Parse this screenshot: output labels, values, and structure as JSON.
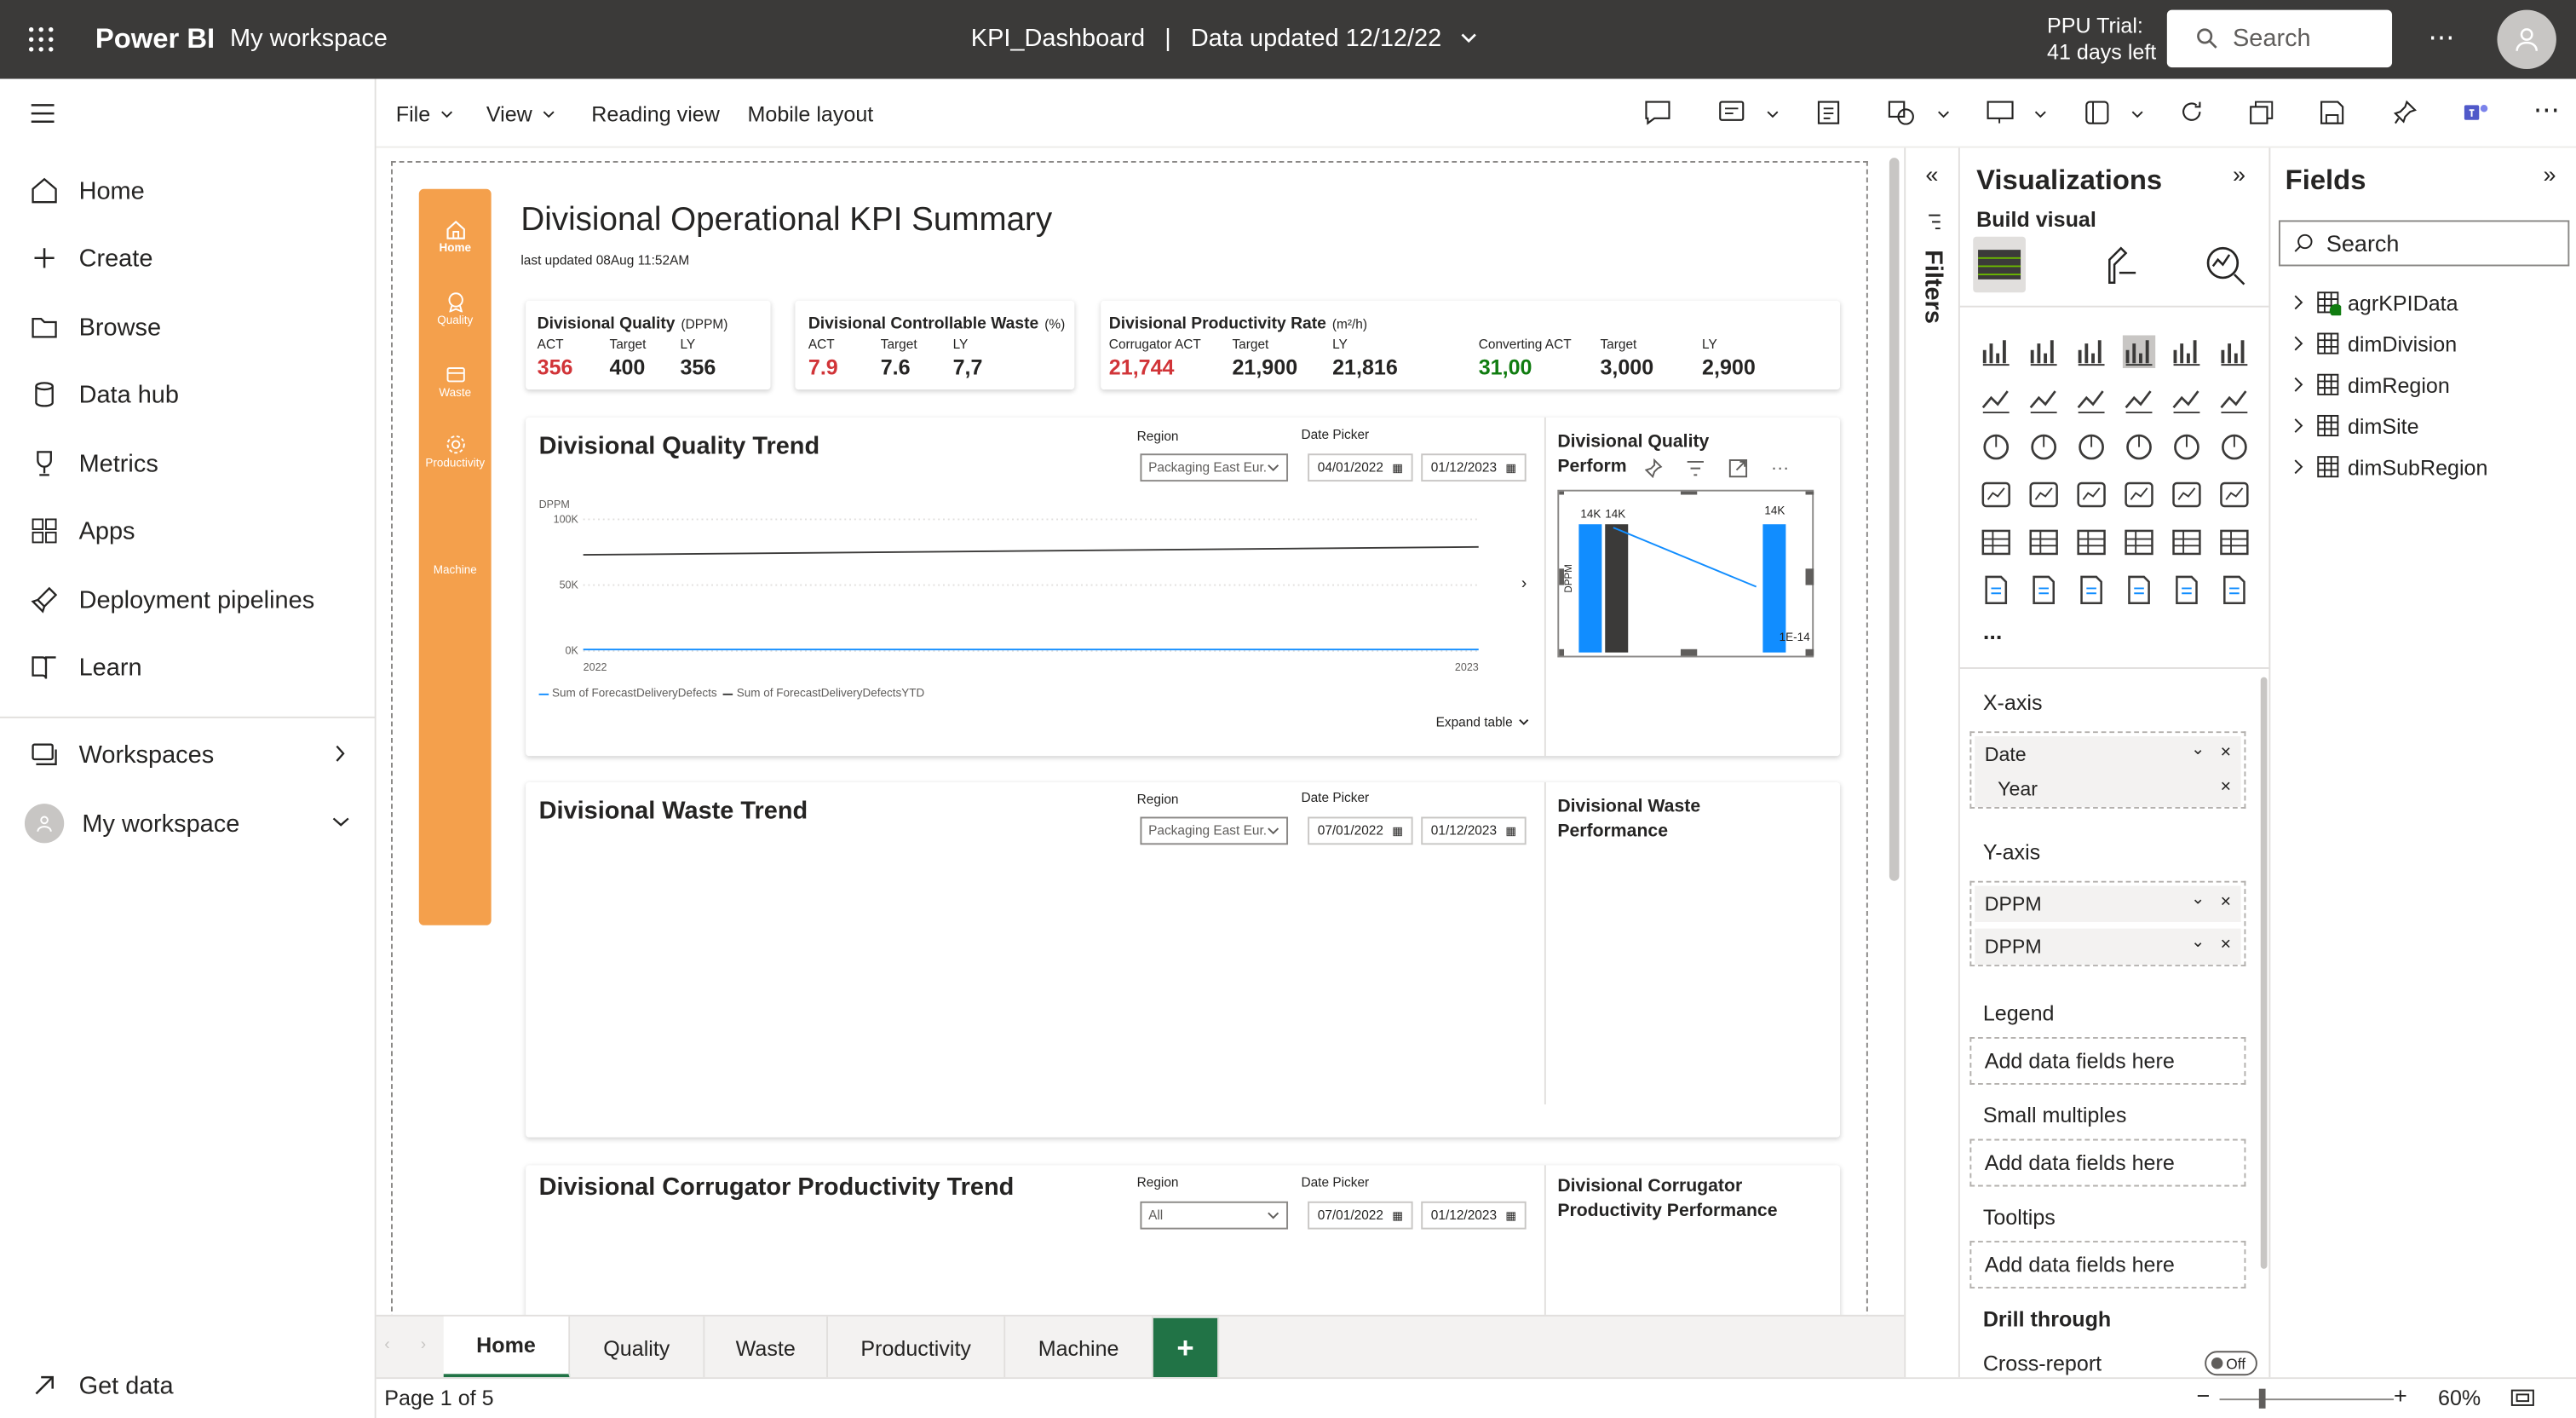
{
  "topbar": {
    "brand": "Power BI",
    "workspace": "My workspace",
    "report_name": "KPI_Dashboard",
    "separator": "|",
    "data_updated": "Data updated 12/12/22",
    "trial_line1": "PPU Trial:",
    "trial_line2": "41 days left",
    "search_placeholder": "Search",
    "more": "⋯"
  },
  "leftnav": {
    "items": [
      {
        "label": "Home",
        "icon": "home-icon"
      },
      {
        "label": "Create",
        "icon": "plus-icon"
      },
      {
        "label": "Browse",
        "icon": "folder-icon"
      },
      {
        "label": "Data hub",
        "icon": "database-icon"
      },
      {
        "label": "Metrics",
        "icon": "trophy-icon"
      },
      {
        "label": "Apps",
        "icon": "apps-icon"
      },
      {
        "label": "Deployment pipelines",
        "icon": "rocket-icon"
      },
      {
        "label": "Learn",
        "icon": "book-icon"
      }
    ],
    "workspaces": "Workspaces",
    "my_workspace": "My workspace",
    "get_data": "Get data"
  },
  "toolbar": {
    "file": "File",
    "view": "View",
    "reading_view": "Reading view",
    "mobile_layout": "Mobile layout"
  },
  "report": {
    "title": "Divisional Operational KPI Summary",
    "last_updated": "last updated 08Aug 11:52AM",
    "side_nav": [
      "Home",
      "Quality",
      "Waste",
      "Productivity",
      "Machine"
    ],
    "kpi_quality": {
      "title": "Divisional Quality",
      "unit": "(DPPM)",
      "labels": [
        "ACT",
        "Target",
        "LY"
      ],
      "values": [
        "356",
        "400",
        "356"
      ]
    },
    "kpi_waste": {
      "title": "Divisional Controllable Waste",
      "unit": "(%)",
      "labels": [
        "ACT",
        "Target",
        "LY"
      ],
      "values": [
        "7.9",
        "7.6",
        "7,7"
      ]
    },
    "kpi_productivity": {
      "title": "Divisional Productivity Rate",
      "unit": "(m²/h)",
      "labels": [
        "Corrugator ACT",
        "Target",
        "LY",
        "Converting ACT",
        "Target",
        "LY"
      ],
      "values": [
        "21,744",
        "21,900",
        "21,816",
        "31,00",
        "3,000",
        "2,900"
      ]
    },
    "quality_trend": {
      "title": "Divisional Quality Trend",
      "region_label": "Region",
      "region_value": "Packaging East Eur...",
      "date_label": "Date Picker",
      "date_from": "04/01/2022",
      "date_to": "01/12/2023",
      "y_unit": "DPPM",
      "yticks": [
        "100K",
        "50K",
        "0K"
      ],
      "xticks": [
        "2022",
        "2023"
      ],
      "legend": [
        "Sum of ForecastDeliveryDefects",
        "Sum of ForecastDeliveryDefectsYTD"
      ],
      "expand": "Expand table",
      "perf_title_1": "Divisional Quality",
      "perf_title_2": "Perform",
      "perf_labels": [
        "14K",
        "14K",
        "14K",
        "1E-14"
      ],
      "perf_axis": "DPPM"
    },
    "waste_trend": {
      "title": "Divisional Waste Trend",
      "region_label": "Region",
      "region_value": "Packaging East Eur...",
      "date_label": "Date Picker",
      "date_from": "07/01/2022",
      "date_to": "01/12/2023",
      "perf_title": "Divisional Waste Performance"
    },
    "corrugator_trend": {
      "title": "Divisional Corrugator Productivity Trend",
      "region_label": "Region",
      "region_value": "All",
      "date_label": "Date Picker",
      "date_from": "07/01/2022",
      "date_to": "01/12/2023",
      "perf_title": "Divisional Corrugator Productivity Performance"
    }
  },
  "chart_data": {
    "type": "line",
    "x": [
      "2022",
      "2023"
    ],
    "series": [
      {
        "name": "Sum of ForecastDeliveryDefects",
        "values": [
          1000,
          1000
        ],
        "color": "#118dff"
      },
      {
        "name": "Sum of ForecastDeliveryDefectsYTD",
        "values": [
          73000,
          79000
        ],
        "color": "#3b3a39"
      }
    ],
    "ylabel": "DPPM",
    "ylim": [
      0,
      100000
    ],
    "yticks": [
      "0K",
      "50K",
      "100K"
    ]
  },
  "tabs": [
    "Home",
    "Quality",
    "Waste",
    "Productivity",
    "Machine"
  ],
  "add_tab": "+",
  "status": {
    "page": "Page 1 of 5",
    "zoom": "60%"
  },
  "filters": {
    "label": "Filters"
  },
  "viz": {
    "title": "Visualizations",
    "build_visual": "Build visual",
    "x_axis": "X-axis",
    "x_fields": [
      "Date",
      "Year"
    ],
    "y_axis": "Y-axis",
    "y_fields": [
      "DPPM",
      "DPPM"
    ],
    "legend": "Legend",
    "small_multiples": "Small multiples",
    "tooltips": "Tooltips",
    "add_here": "Add data fields here",
    "drill_through": "Drill through",
    "cross_report": "Cross-report",
    "off": "Off",
    "more": "..."
  },
  "fields": {
    "title": "Fields",
    "search_placeholder": "Search",
    "tables": [
      "agrKPIData",
      "dimDivision",
      "dimRegion",
      "dimSite",
      "dimSubRegion"
    ]
  },
  "colors": {
    "accent_orange": "#f4a04c",
    "topbar": "#3b3a39",
    "red": "#d13438",
    "green": "#107c10",
    "bar_blue": "#118dff",
    "tab_add": "#217346"
  }
}
